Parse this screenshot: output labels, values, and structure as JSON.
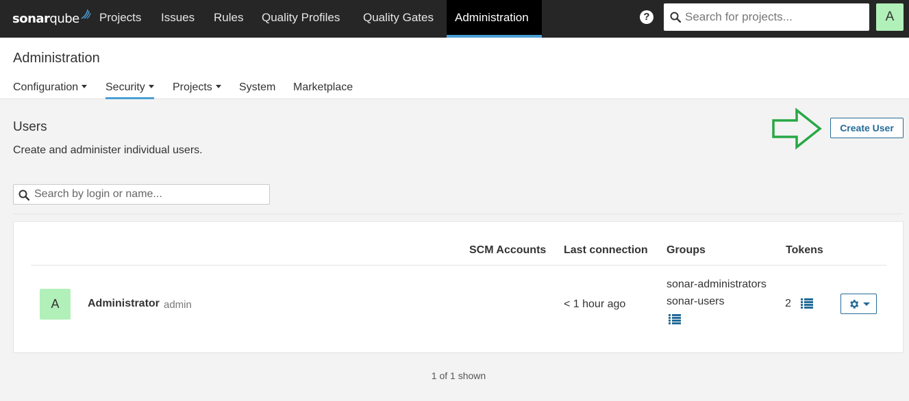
{
  "topnav": {
    "logo": {
      "part1": "sonar",
      "part2": "qube"
    },
    "items": [
      {
        "label": "Projects"
      },
      {
        "label": "Issues"
      },
      {
        "label": "Rules"
      },
      {
        "label": "Quality Profiles"
      },
      {
        "label": "Quality Gates"
      },
      {
        "label": "Administration",
        "active": true
      }
    ],
    "help_glyph": "?",
    "search_placeholder": "Search for projects...",
    "user_initial": "A"
  },
  "header": {
    "title": "Administration",
    "subnav": [
      {
        "label": "Configuration",
        "dropdown": true
      },
      {
        "label": "Security",
        "dropdown": true,
        "active": true
      },
      {
        "label": "Projects",
        "dropdown": true
      },
      {
        "label": "System",
        "dropdown": false
      },
      {
        "label": "Marketplace",
        "dropdown": false
      }
    ]
  },
  "users": {
    "title": "Users",
    "description": "Create and administer individual users.",
    "create_label": "Create User",
    "search_placeholder": "Search by login or name...",
    "columns": [
      "SCM Accounts",
      "Last connection",
      "Groups",
      "Tokens"
    ],
    "rows": [
      {
        "initial": "A",
        "name": "Administrator",
        "login": "admin",
        "last_connection": "< 1 hour ago",
        "groups": [
          "sonar-administrators",
          "sonar-users"
        ],
        "tokens": "2"
      }
    ],
    "shown_count": "1 of 1 shown"
  },
  "colors": {
    "topbar_bg": "#262626",
    "active_accent": "#4b9fd5",
    "link_blue": "#236a97",
    "avatar_green": "#b1f0b9",
    "annotation_arrow": "#27a845"
  },
  "icons": [
    "sonarqube-logo-icon",
    "help-icon",
    "search-icon",
    "list-icon",
    "gear-icon",
    "chevron-down-icon",
    "arrow-right-annotation-icon"
  ]
}
